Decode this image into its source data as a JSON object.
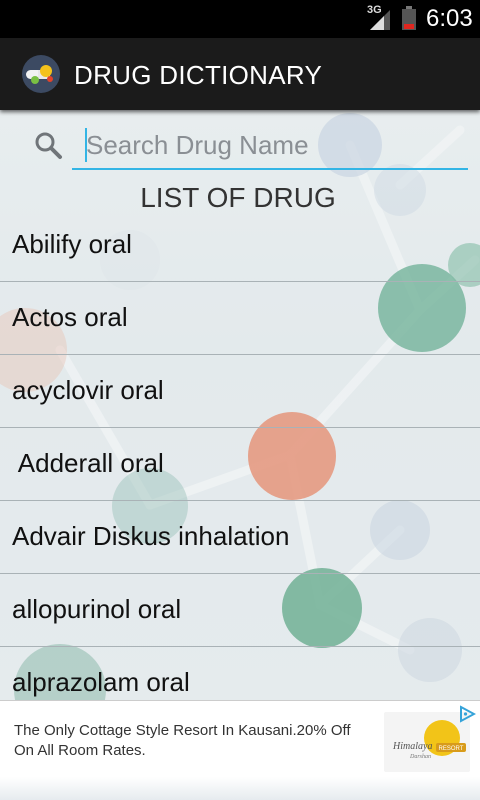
{
  "status_bar": {
    "network": "3G",
    "time": "6:03"
  },
  "action_bar": {
    "title": "DRUG DICTIONARY",
    "icon": "pill-app-icon"
  },
  "search": {
    "placeholder": "Search Drug Name",
    "value": "",
    "icon": "search-icon",
    "accent": "#33b5e5"
  },
  "list": {
    "title": "LIST OF DRUG",
    "items": [
      "Abilify oral",
      "Actos oral",
      "acyclovir oral",
      " Adderall oral",
      "Advair Diskus inhalation",
      "allopurinol oral",
      "alprazolam oral"
    ]
  },
  "ad": {
    "text": "The Only Cottage Style Resort In Kausani.20% Off On All Room Rates.",
    "logo_text": "Himalaya",
    "logo_badge": "RESORT",
    "logo_subtext": "Darshan",
    "choice_icon": "adchoices-icon"
  }
}
